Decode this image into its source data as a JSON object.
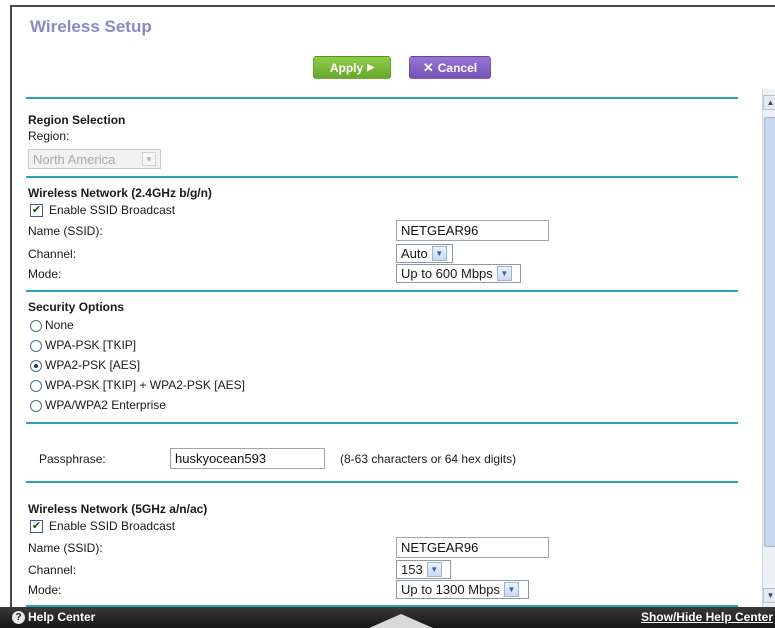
{
  "page": {
    "title": "Wireless Setup"
  },
  "toolbar": {
    "apply_label": "Apply",
    "apply_icon": "▶",
    "cancel_label": "Cancel",
    "cancel_icon": "✕"
  },
  "region": {
    "heading": "Region Selection",
    "label": "Region:",
    "value": "North America"
  },
  "wireless24": {
    "heading": "Wireless Network (2.4GHz b/g/n)",
    "enable_ssid_label": "Enable SSID Broadcast",
    "enable_ssid_checked": true,
    "name_label": "Name (SSID):",
    "name_value": "NETGEAR96",
    "channel_label": "Channel:",
    "channel_value": "Auto",
    "mode_label": "Mode:",
    "mode_value": "Up to 600 Mbps"
  },
  "security": {
    "heading": "Security Options",
    "options": [
      {
        "label": "None",
        "checked": false
      },
      {
        "label": "WPA-PSK [TKIP]",
        "checked": false
      },
      {
        "label": "WPA2-PSK [AES]",
        "checked": true
      },
      {
        "label": "WPA-PSK [TKIP] + WPA2-PSK [AES]",
        "checked": false
      },
      {
        "label": "WPA/WPA2 Enterprise",
        "checked": false
      }
    ]
  },
  "passphrase": {
    "label": "Passphrase:",
    "value": "huskyocean593",
    "hint": "(8-63 characters or 64 hex digits)"
  },
  "wireless5": {
    "heading": "Wireless Network (5GHz a/n/ac)",
    "enable_ssid_label": "Enable SSID Broadcast",
    "enable_ssid_checked": true,
    "name_label": "Name (SSID):",
    "name_value": "NETGEAR96",
    "channel_label": "Channel:",
    "channel_value": "153",
    "mode_label": "Mode:",
    "mode_value": "Up to 1300 Mbps"
  },
  "footer": {
    "help_center": "Help Center",
    "show_hide": "Show/Hide Help Center"
  },
  "colors": {
    "title": "#8a88c6",
    "divider": "#2f9fb5",
    "apply_button": "#7cbb39",
    "cancel_button": "#8462c8",
    "footer_bg": "#1e1e1e"
  }
}
